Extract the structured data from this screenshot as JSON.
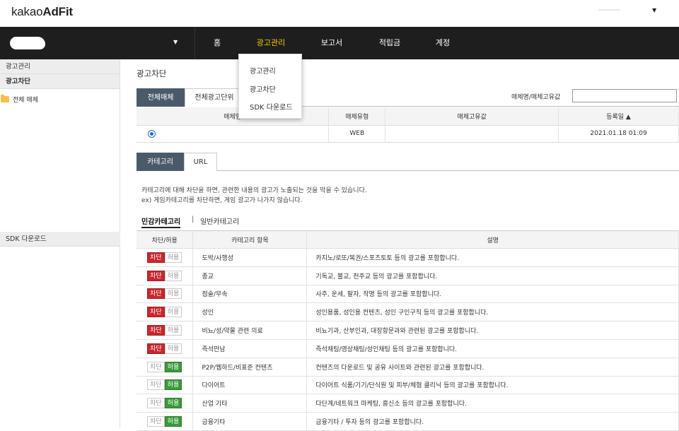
{
  "logo": {
    "prefix": "kakao",
    "brand": "AdFit"
  },
  "nav": {
    "items": [
      {
        "label": "홈"
      },
      {
        "label": "광고관리"
      },
      {
        "label": "보고서"
      },
      {
        "label": "적립금"
      },
      {
        "label": "계정"
      }
    ]
  },
  "dropdown": {
    "items": [
      {
        "label": "광고관리"
      },
      {
        "label": "광고차단"
      },
      {
        "label": "SDK 다운로드"
      }
    ]
  },
  "sidebar": {
    "manage": "광고관리",
    "block": "광고차단",
    "tree_item": "전체 매체",
    "sdk": "SDK 다운로드"
  },
  "page": {
    "title": "광고차단",
    "tabs": [
      "전체매체",
      "전체광고단위"
    ],
    "search_label": "매체명/매체고유값",
    "search_value": ""
  },
  "media_table": {
    "headers": [
      "매체명",
      "매체유형",
      "매체고유값",
      "등록일 ▲"
    ],
    "rows": [
      {
        "name": "",
        "type": "WEB",
        "id": "",
        "date": "2021.01.18 01:09"
      }
    ]
  },
  "filter_tabs": [
    "카테고리",
    "URL"
  ],
  "description": {
    "line1": "카테고리에 대해 차단을 하면, 관련한 내용의 광고가 노출되는 것을 막을 수 있습니다.",
    "line2": "ex) 게임카테고리를 차단하면, 게임 광고가 나가지 않습니다."
  },
  "sub_tabs": {
    "sensitive": "민감카테고리",
    "separator": "|",
    "general": "일반카테고리"
  },
  "toggle_labels": {
    "block": "차단",
    "allow": "허용"
  },
  "category_table": {
    "headers": [
      "차단/허용",
      "카테고리 항목",
      "설명"
    ],
    "rows": [
      {
        "state": "block",
        "category": "도박/사행성",
        "desc": "카지노/로또/복권/스포츠토토 등의 광고를 포함합니다."
      },
      {
        "state": "block",
        "category": "종교",
        "desc": "기독교, 불교, 천주교 등의 광고를 포함합니다."
      },
      {
        "state": "block",
        "category": "점술/무속",
        "desc": "사주, 운세, 팔자, 작명 등의 광고를 포함합니다."
      },
      {
        "state": "block",
        "category": "성인",
        "desc": "성인용품, 성인용 컨텐츠, 성인 구인구직 등의 광고를 포함합니다."
      },
      {
        "state": "block",
        "category": "비뇨/성/약물 관련 의료",
        "desc": "비뇨기과, 산부인과, 대장항문과와 관련된 광고를 포함합니다."
      },
      {
        "state": "block",
        "category": "즉석만남",
        "desc": "즉석채팅/영상채팅/성인채팅 등의 광고를 포함합니다."
      },
      {
        "state": "allow",
        "category": "P2P/웹하드/비표준 컨텐츠",
        "desc": "컨텐츠의 다운로드 및 공유 사이트와 관련된 광고를 포함합니다."
      },
      {
        "state": "allow",
        "category": "다이어트",
        "desc": "다이어트 식품/기기/단식원 및 피부/체형 클리닉 등의 광고를 포함합니다."
      },
      {
        "state": "allow",
        "category": "산업 기타",
        "desc": "다단계/네트워크 마케팅, 흥신소 등의 광고를 포함합니다."
      },
      {
        "state": "allow",
        "category": "금융기타",
        "desc": "금융기타 / 투자 등의 광고를 포함합니다."
      }
    ]
  }
}
